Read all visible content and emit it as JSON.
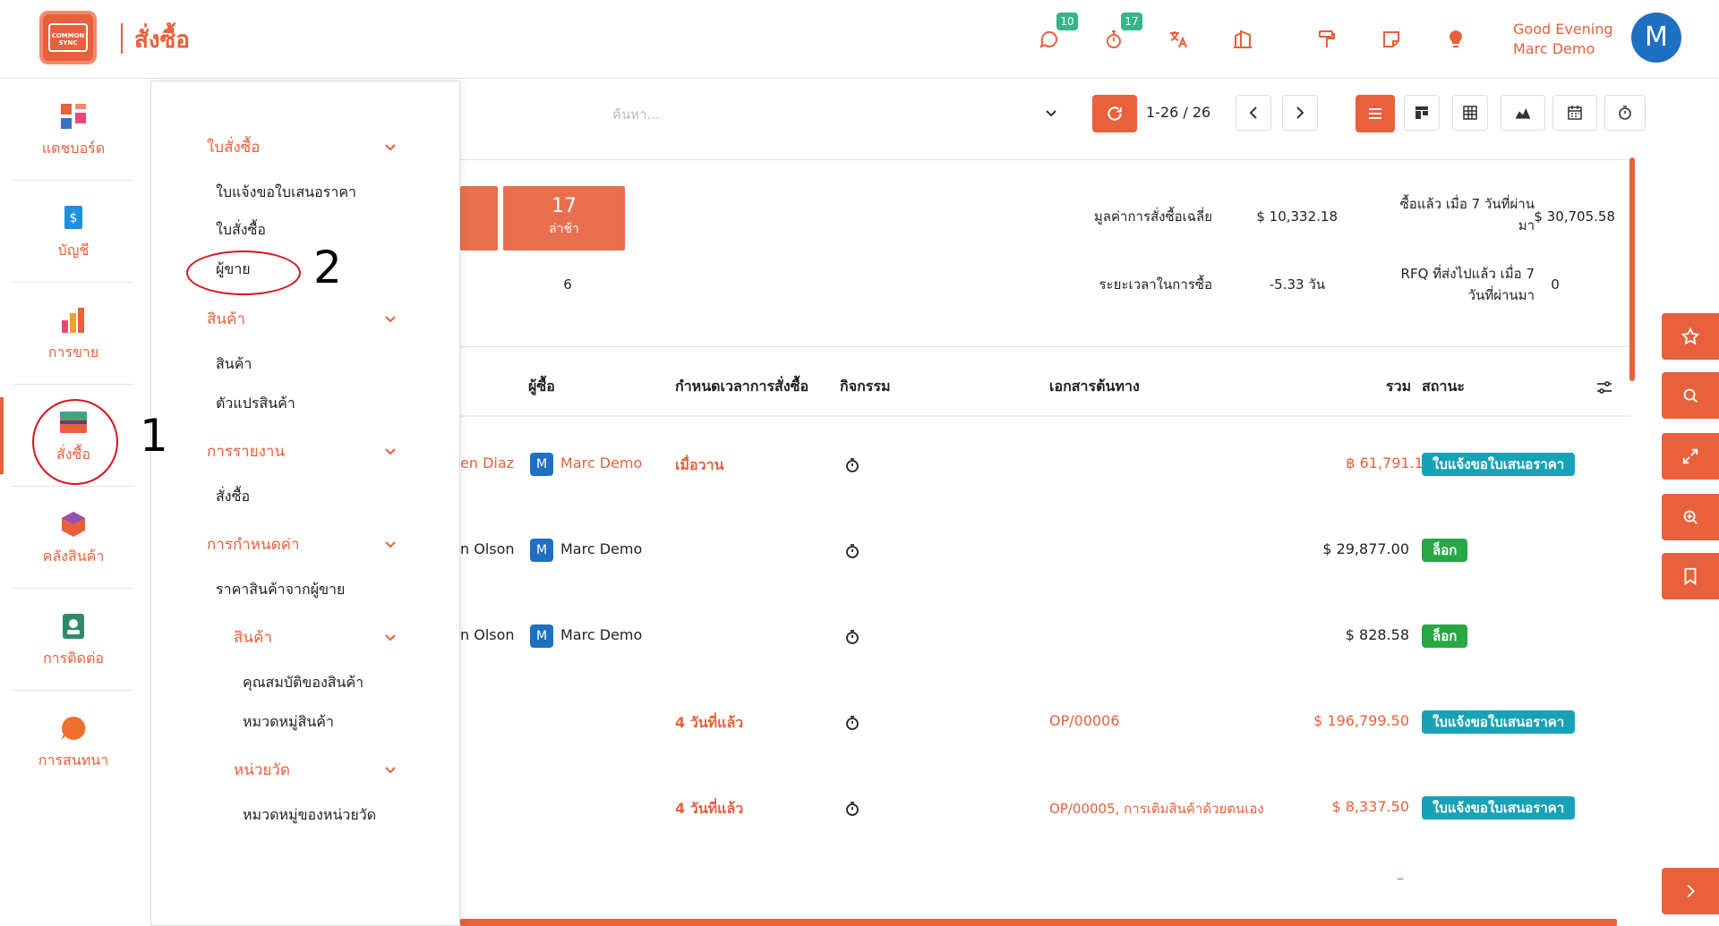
{
  "header": {
    "logo_text": "COMMON SYNC",
    "app_title": "สั่งซื้อ",
    "messages_badge": "10",
    "activities_badge": "17",
    "greeting_line1": "Good Evening",
    "greeting_line2": "Marc Demo",
    "avatar_letter": "M"
  },
  "rail": {
    "items": [
      {
        "label": "แดชบอร์ด"
      },
      {
        "label": "บัญชี"
      },
      {
        "label": "การขาย"
      },
      {
        "label": "สั่งซื้อ"
      },
      {
        "label": "คลังสินค้า"
      },
      {
        "label": "การติดต่อ"
      },
      {
        "label": "การสนทนา"
      }
    ]
  },
  "menu": {
    "sec_purchase": "ใบสั่งซื้อ",
    "rfq": "ใบแจ้งขอใบเสนอราคา",
    "purchase_orders": "ใบสั่งซื้อ",
    "vendors": "ผู้ขาย",
    "sec_products": "สินค้า",
    "products": "สินค้า",
    "variants": "ตัวแปรสินค้า",
    "sec_reporting": "การรายงาน",
    "report_purchase": "สั่งซื้อ",
    "sec_config": "การกำหนดค่า",
    "vendor_pricelists": "ราคาสินค้าจากผู้ขาย",
    "sub_products": "สินค้า",
    "product_attributes": "คุณสมบัติของสินค้า",
    "product_categories": "หมวดหมู่สินค้า",
    "sub_uom": "หน่วยวัด",
    "uom_categories": "หมวดหมู่ของหน่วยวัด"
  },
  "annotations": {
    "one": "1",
    "two": "2"
  },
  "toolbar": {
    "search_placeholder": "ค้นหา...",
    "pager": "1-26 / 26"
  },
  "stats": {
    "late_count": "17",
    "late_label": "ล่าช้า",
    "row2_value": "6",
    "avg_order_label": "มูลค่าการสั่งซื้อเฉลี่ย",
    "avg_order_value": "$ 10,332.18",
    "bought7_label_1": "ซื้อแล้ว เมื่อ 7 วันที่ผ่าน",
    "bought7_label_2": "มา",
    "bought7_value": "$ 30,705.58",
    "lead_label": "ระยะเวลาในการซื้อ",
    "lead_value": "-5.33 วัน",
    "rfq_sent_label_1": "RFQ ที่ส่งไปแล้ว เมื่อ 7",
    "rfq_sent_label_2": "วันที่ผ่านมา",
    "rfq_sent_value": "0"
  },
  "table": {
    "col_buyer": "ผู้ซื้อ",
    "col_deadline": "กำหนดเวลาการสั่งซื้อ",
    "col_activity": "กิจกรรม",
    "col_source": "เอกสารต้นทาง",
    "col_total": "รวม",
    "col_status": "สถานะ",
    "rows": [
      {
        "vendor": "en Diaz",
        "buyer_initial": "M",
        "buyer": "Marc Demo",
        "deadline": "เมื่อวาน",
        "source": "",
        "total": "61,791.12 ฿",
        "status": "ใบแจ้งขอใบเสนอราคา"
      },
      {
        "vendor": "n Olson",
        "buyer_initial": "M",
        "buyer": "Marc Demo",
        "deadline": "",
        "source": "",
        "total": "$ 29,877.00",
        "status": "ล็อก"
      },
      {
        "vendor": "n Olson",
        "buyer_initial": "M",
        "buyer": "Marc Demo",
        "deadline": "",
        "source": "",
        "total": "$ 828.58",
        "status": "ล็อก"
      },
      {
        "vendor": "",
        "buyer_initial": "",
        "buyer": "",
        "deadline": "4 วันที่แล้ว",
        "source": "OP/00006",
        "total": "$ 196,799.50",
        "status": "ใบแจ้งขอใบเสนอราคา"
      },
      {
        "vendor": "",
        "buyer_initial": "",
        "buyer": "",
        "deadline": "4 วันที่แล้ว",
        "source": "OP/00005, การเติมสินค้าด้วยตนเอง",
        "total": "$ 8,337.50",
        "status": "ใบแจ้งขอใบเสนอราคา"
      }
    ],
    "trailing_dash": "–"
  },
  "colors": {
    "accent": "#e8603c",
    "teal": "#17a2b8",
    "green": "#28a745",
    "blue": "#1f6fc2"
  }
}
